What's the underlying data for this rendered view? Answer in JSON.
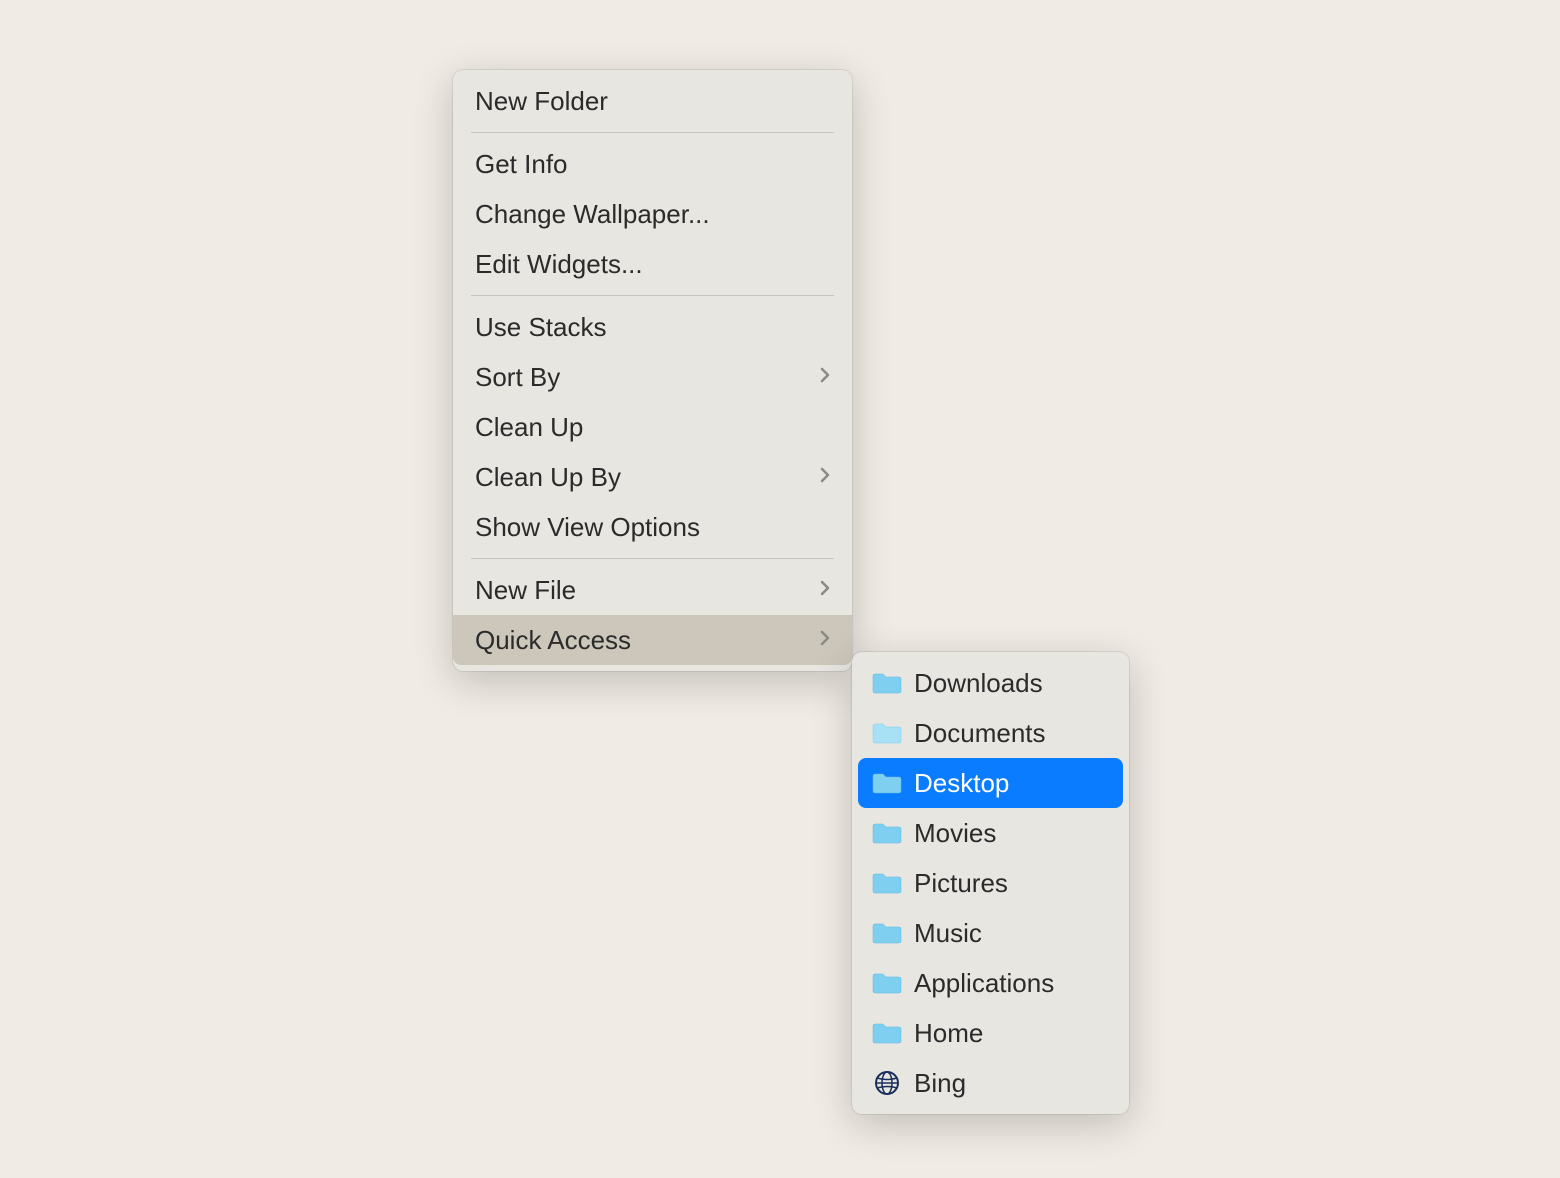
{
  "mainMenu": {
    "groups": [
      [
        {
          "label": "New Folder",
          "submenu": false
        }
      ],
      [
        {
          "label": "Get Info",
          "submenu": false
        },
        {
          "label": "Change Wallpaper...",
          "submenu": false
        },
        {
          "label": "Edit Widgets...",
          "submenu": false
        }
      ],
      [
        {
          "label": "Use Stacks",
          "submenu": false
        },
        {
          "label": "Sort By",
          "submenu": true
        },
        {
          "label": "Clean Up",
          "submenu": false
        },
        {
          "label": "Clean Up By",
          "submenu": true
        },
        {
          "label": "Show View Options",
          "submenu": false
        }
      ],
      [
        {
          "label": "New File",
          "submenu": true
        },
        {
          "label": "Quick Access",
          "submenu": true,
          "highlighted": true
        }
      ]
    ]
  },
  "subMenu": {
    "items": [
      {
        "label": "Downloads",
        "icon": "folder",
        "selected": false
      },
      {
        "label": "Documents",
        "icon": "folder",
        "selected": false
      },
      {
        "label": "Desktop",
        "icon": "folder",
        "selected": true
      },
      {
        "label": "Movies",
        "icon": "folder",
        "selected": false
      },
      {
        "label": "Pictures",
        "icon": "folder",
        "selected": false
      },
      {
        "label": "Music",
        "icon": "folder",
        "selected": false
      },
      {
        "label": "Applications",
        "icon": "folder",
        "selected": false
      },
      {
        "label": "Home",
        "icon": "folder",
        "selected": false
      },
      {
        "label": "Bing",
        "icon": "globe",
        "selected": false
      }
    ]
  },
  "colors": {
    "background": "#f0ebe4",
    "menuBackground": "#e8e6e1",
    "selectionBlue": "#0a7cff",
    "highlightGray": "#ccc7ba",
    "folderFill": "#7fd0f0",
    "folderFillSelected": "#a0d8f5"
  }
}
